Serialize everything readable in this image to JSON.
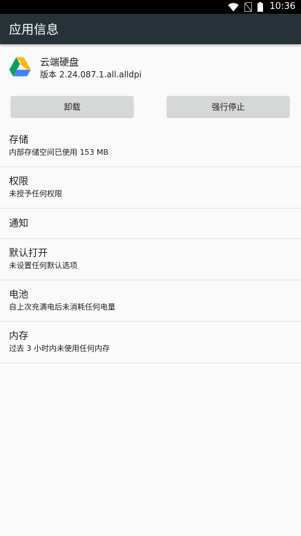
{
  "status_bar": {
    "time": "10:36",
    "icons": [
      "wifi-icon",
      "no-sim-icon",
      "battery-icon"
    ]
  },
  "app_bar": {
    "title": "应用信息",
    "background": "#263238"
  },
  "app": {
    "name": "云端硬盘",
    "version": "版本 2.24.087.1.all.alldpi",
    "icon": "google-drive-icon"
  },
  "actions": {
    "uninstall_label": "卸载",
    "force_stop_label": "强行停止"
  },
  "settings": {
    "items": [
      {
        "title": "存储",
        "summary": "内部存储空间已使用 153 MB"
      },
      {
        "title": "权限",
        "summary": "未授予任何权限"
      },
      {
        "title": "通知",
        "summary": ""
      },
      {
        "title": "默认打开",
        "summary": "未设置任何默认选项"
      },
      {
        "title": "电池",
        "summary": "自上次充满电后未消耗任何电量"
      },
      {
        "title": "内存",
        "summary": "过去 3 小时内未使用任何内存"
      }
    ]
  }
}
